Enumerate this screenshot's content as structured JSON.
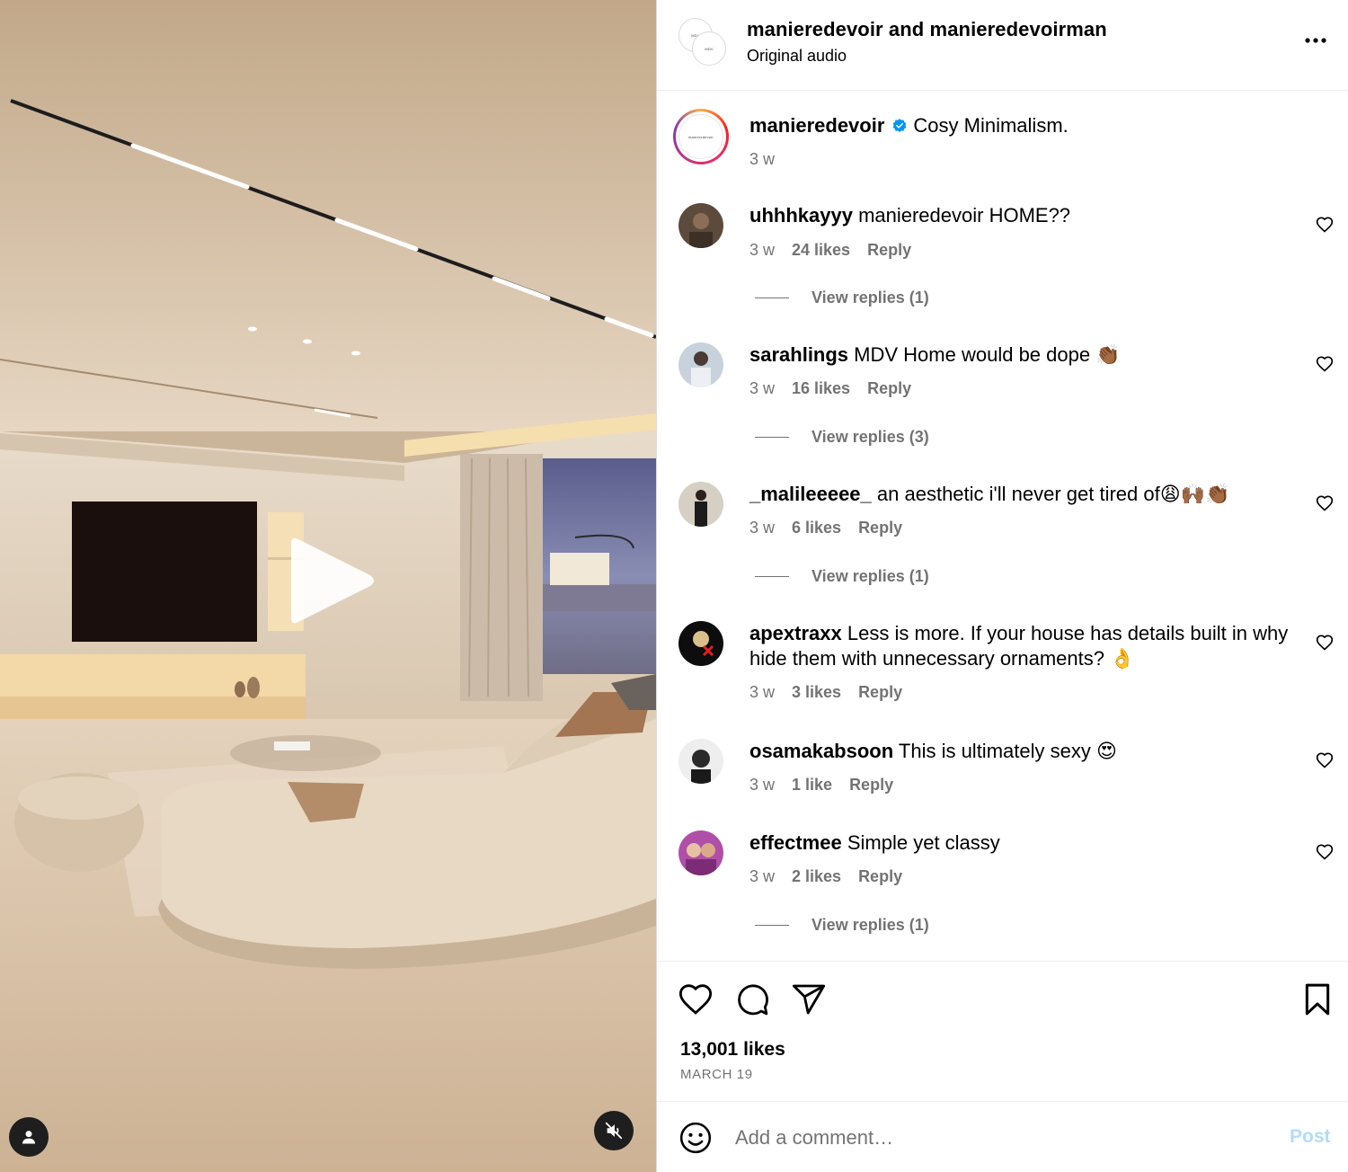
{
  "header": {
    "title": "manieredevoir and manieredevoirman",
    "subtitle": "Original audio"
  },
  "caption": {
    "username": "manieredevoir",
    "text": "Cosy Minimalism.",
    "time": "3 w"
  },
  "comments": [
    {
      "username": "uhhhkayyy",
      "text": "manieredevoir HOME??",
      "time": "3 w",
      "likes": "24 likes",
      "reply": "Reply",
      "view_replies": "View replies (1)"
    },
    {
      "username": "sarahlings",
      "text": "MDV Home would be dope 👏🏾",
      "time": "3 w",
      "likes": "16 likes",
      "reply": "Reply",
      "view_replies": "View replies (3)"
    },
    {
      "username": "_malileeeee_",
      "text": "an aesthetic i'll never get tired of😩🙌🏾👏🏾",
      "time": "3 w",
      "likes": "6 likes",
      "reply": "Reply",
      "view_replies": "View replies (1)"
    },
    {
      "username": "apextraxx",
      "text": "Less is more. If your house has details built in why hide them with unnecessary ornaments? 👌",
      "time": "3 w",
      "likes": "3 likes",
      "reply": "Reply"
    },
    {
      "username": "osamakabsoon",
      "text": "This is ultimately sexy 😍",
      "time": "3 w",
      "likes": "1 like",
      "reply": "Reply"
    },
    {
      "username": "effectmee",
      "text": "Simple yet classy",
      "time": "3 w",
      "likes": "2 likes",
      "reply": "Reply",
      "view_replies": "View replies (1)"
    }
  ],
  "footer": {
    "likes": "13,001 likes",
    "date": "MARCH 19",
    "comment_placeholder": "Add a comment…",
    "post_label": "Post"
  },
  "icons": {
    "more": "more-horizontal-icon",
    "verified": "verified-badge-icon",
    "heart": "heart-outline-icon",
    "comment": "comment-bubble-icon",
    "share": "paper-plane-icon",
    "save": "bookmark-icon",
    "emoji": "smiley-icon",
    "play": "play-icon",
    "user_tag": "user-silhouette-icon",
    "mute": "speaker-muted-icon"
  },
  "colors": {
    "secondary_text": "#737373",
    "post_button_disabled": "#b3dbff",
    "verified": "#0095f6",
    "icon_button_bg": "#1e1e1e"
  }
}
